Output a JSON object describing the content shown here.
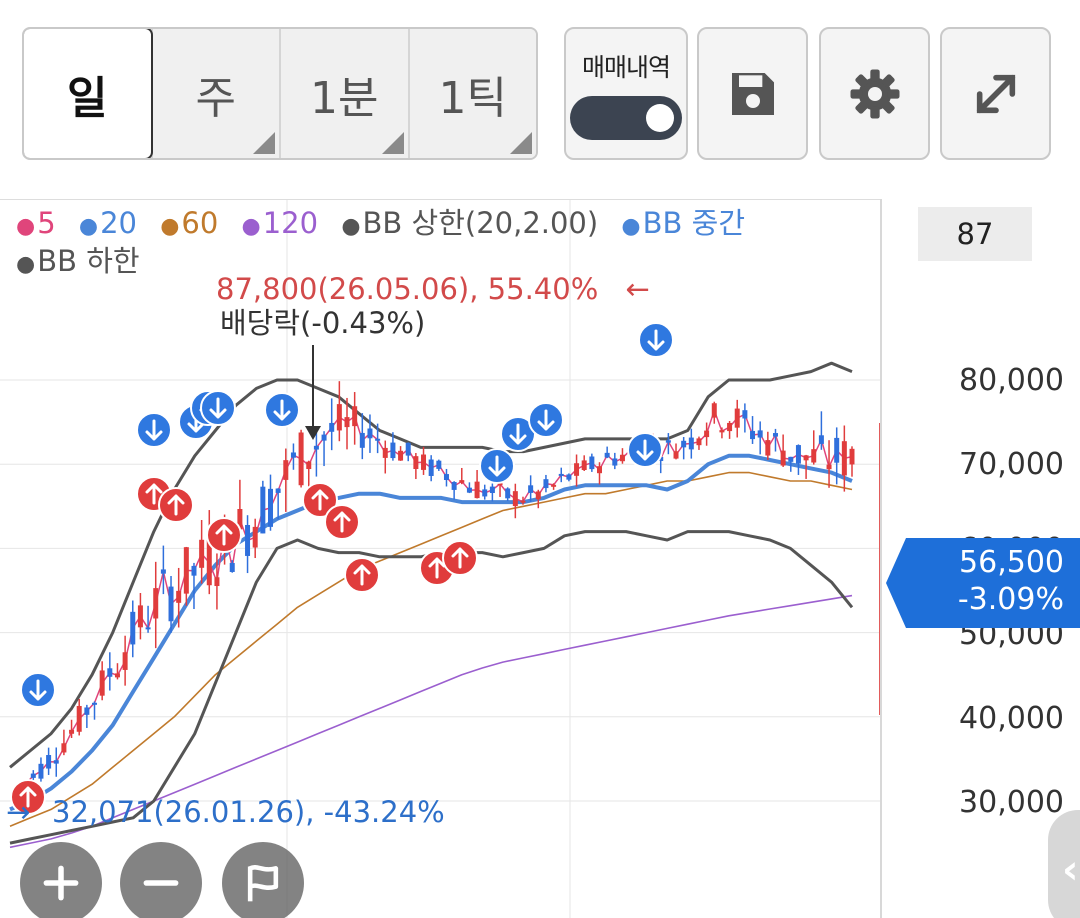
{
  "toolbar": {
    "periods": [
      {
        "label": "일",
        "active": true
      },
      {
        "label": "주",
        "active": false
      },
      {
        "label": "1분",
        "active": false
      },
      {
        "label": "1틱",
        "active": false
      }
    ],
    "trade_history_label": "매매내역",
    "trade_history_on": true,
    "icons": [
      "save-icon",
      "gear-icon",
      "expand-icon"
    ]
  },
  "legend": {
    "ma5": "5",
    "ma20": "20",
    "ma60": "60",
    "ma120": "120",
    "bb_upper": "BB 상한(20,2.00)",
    "bb_middle": "BB 중간",
    "bb_lower": "BB 하한",
    "colors": {
      "ma5": "#e0457b",
      "ma20": "#4a86d8",
      "ma60": "#c07a2c",
      "ma120": "#9b5fcf",
      "bb": "#555555",
      "up": "#e03c3c",
      "down": "#2f6fdc"
    }
  },
  "price_box": "87",
  "annotations": {
    "high": "87,800(26.05.06), 55.40%",
    "high_arrow": "←",
    "dividend": "배당락(-0.43%)",
    "low": "32,071(26.01.26), -43.24%",
    "low_arrow": "→"
  },
  "current_price": {
    "value": "56,500",
    "change": "-3.09%"
  },
  "chart_data": {
    "type": "line",
    "y_ticks": [
      "80,000",
      "70,000",
      "60,000",
      "50,000",
      "40,000",
      "30,000"
    ],
    "ylim": [
      24000,
      90000
    ],
    "high": 87800,
    "low": 32071,
    "last": 56500,
    "bb_upper": [
      34000,
      36000,
      38000,
      41000,
      45000,
      50000,
      56000,
      62000,
      67000,
      71000,
      74000,
      77000,
      79000,
      80000,
      80000,
      79000,
      78000,
      76000,
      74000,
      73000,
      72000,
      72000,
      72000,
      72000,
      71500,
      71500,
      72000,
      72500,
      73000,
      73000,
      73000,
      73000,
      73000,
      74000,
      78000,
      80000,
      80000,
      80000,
      80500,
      81000,
      82000,
      81000
    ],
    "bb_middle": [
      29000,
      30000,
      31500,
      33500,
      36000,
      39000,
      43000,
      47000,
      51000,
      55000,
      58000,
      60500,
      62000,
      63500,
      64500,
      65500,
      66000,
      66500,
      66500,
      66000,
      66000,
      66000,
      65500,
      65500,
      65500,
      65500,
      66000,
      67000,
      67500,
      67500,
      67500,
      67500,
      67000,
      68000,
      70000,
      71000,
      71000,
      70500,
      70000,
      69500,
      69000,
      68000
    ],
    "bb_lower": [
      25000,
      25500,
      26000,
      26500,
      27000,
      27500,
      28000,
      30000,
      34000,
      38000,
      44000,
      50000,
      56000,
      60000,
      61000,
      60000,
      59500,
      59500,
      59000,
      59000,
      59000,
      59500,
      59500,
      59500,
      59000,
      59500,
      60000,
      61500,
      62000,
      62000,
      62000,
      61500,
      61000,
      62000,
      62000,
      62000,
      61500,
      61000,
      60000,
      58000,
      56000,
      53000
    ],
    "ma60": [
      27000,
      28000,
      29000,
      30500,
      32000,
      34000,
      36000,
      38000,
      40000,
      42500,
      45000,
      47000,
      49000,
      51000,
      53000,
      54500,
      56000,
      57500,
      58500,
      59500,
      60500,
      61500,
      62500,
      63500,
      64500,
      65000,
      65500,
      66000,
      66500,
      66500,
      67000,
      67500,
      68000,
      68000,
      68500,
      69000,
      69000,
      68500,
      68000,
      68000,
      67500,
      67000
    ],
    "ma120": [
      24500,
      25000,
      25500,
      26200,
      27000,
      28000,
      29000,
      30000,
      31000,
      32000,
      33000,
      34000,
      35000,
      36000,
      37000,
      38000,
      39000,
      40000,
      41000,
      42000,
      43000,
      44000,
      45000,
      45800,
      46500,
      47000,
      47500,
      48000,
      48500,
      49000,
      49500,
      50000,
      50500,
      51000,
      51500,
      52000,
      52400,
      52800,
      53200,
      53600,
      54000,
      54400
    ]
  }
}
